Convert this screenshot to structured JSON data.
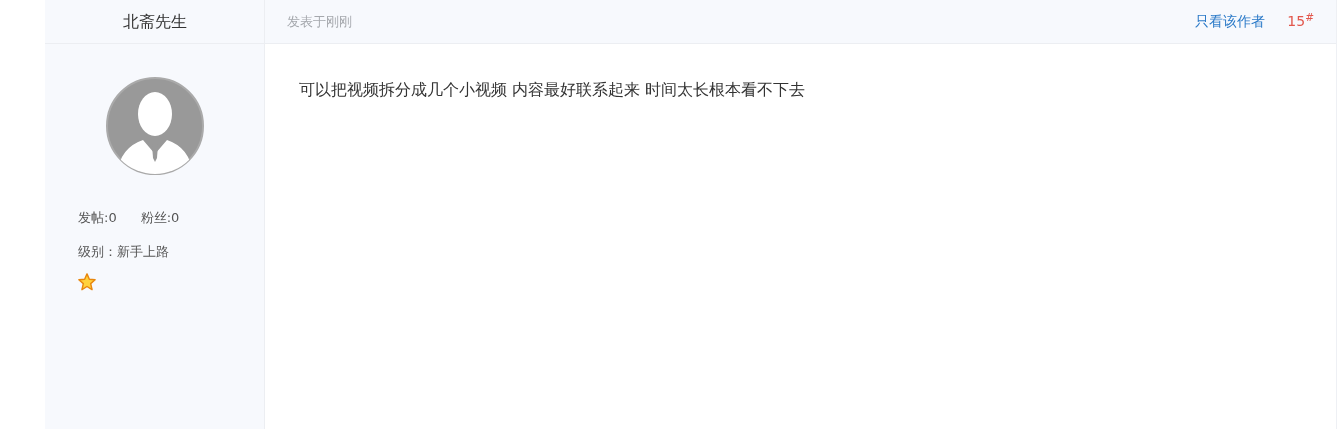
{
  "author": {
    "name": "北斋先生",
    "posts": "发帖:0",
    "fans": "粉丝:0",
    "level": "级别：新手上路"
  },
  "post_header": {
    "time": "发表于刚刚",
    "author_only_link": "只看该作者",
    "floor": "15$^{#}$"
  },
  "post_body": {
    "text": "可以把视频拆分成几个小视频 内容最好联系起来  时间太长根本看不下去"
  }
}
